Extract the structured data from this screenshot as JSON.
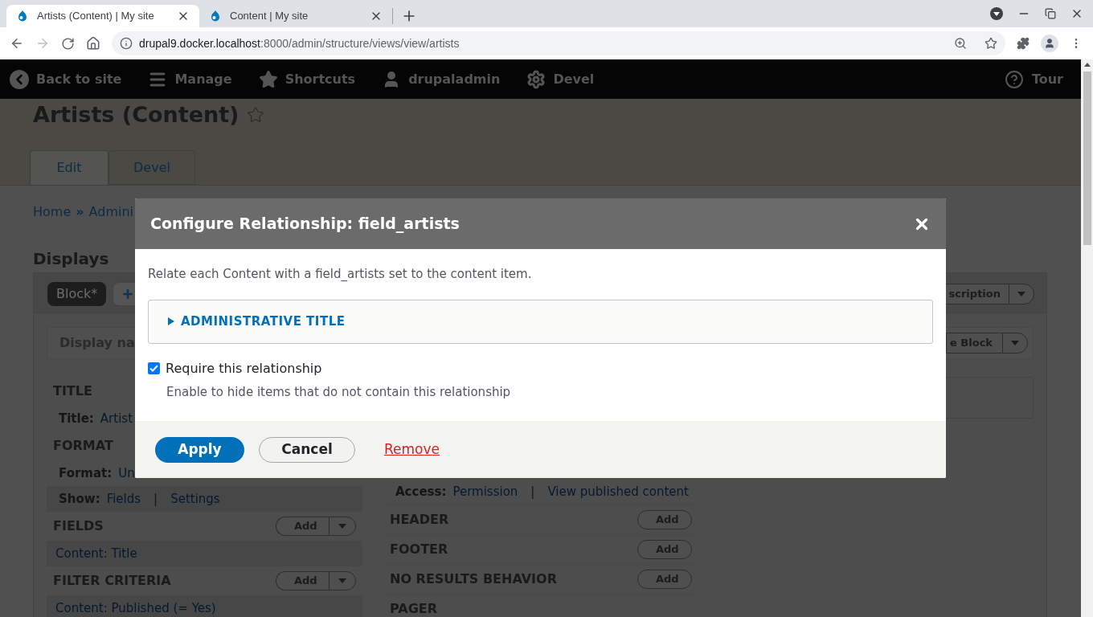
{
  "browser": {
    "tabs": [
      {
        "title": "Artists (Content) | My site",
        "selected": true
      },
      {
        "title": "Content | My site",
        "selected": false
      }
    ],
    "url_host": "drupal9.docker.localhost",
    "url_path": ":8000/admin/structure/views/view/artists"
  },
  "toolbar": {
    "items": [
      {
        "label": "Back to site",
        "kind": "back"
      },
      {
        "label": "Manage",
        "kind": "menu"
      },
      {
        "label": "Shortcuts",
        "kind": "star"
      },
      {
        "label": "drupaladmin",
        "kind": "user"
      },
      {
        "label": "Devel",
        "kind": "gear"
      }
    ],
    "tour": "Tour"
  },
  "page": {
    "title": "Artists (Content)",
    "tabs": [
      {
        "label": "Edit",
        "selected": true
      },
      {
        "label": "Devel",
        "selected": false
      }
    ],
    "breadcrumb": {
      "items": [
        "Home",
        "Admini"
      ],
      "separator": "»"
    },
    "displays": {
      "heading": "Displays",
      "display_tabs": [
        {
          "label": "Block*",
          "selected": true
        }
      ],
      "right_button": "scription",
      "display_name_label": "Display na",
      "display_name_button": "e Block",
      "link_separator": "|",
      "left_sections": [
        {
          "heading": "TITLE",
          "rows": [
            {
              "label": "Title:",
              "links": [
                "Artist"
              ]
            }
          ]
        },
        {
          "heading": "FORMAT",
          "rows": [
            {
              "label": "Format:",
              "links": [
                "Un"
              ]
            },
            {
              "label": "Show:",
              "links": [
                "Fields",
                "Settings"
              ]
            }
          ]
        },
        {
          "heading": "FIELDS",
          "add": "Add",
          "dropdown": true,
          "items": [
            "Content: Title"
          ]
        },
        {
          "heading": "FILTER CRITERIA",
          "add": "Add",
          "dropdown": true,
          "items": [
            "Content: Published (= Yes)"
          ]
        }
      ],
      "right_rows": [
        {
          "label": "Access:",
          "links": [
            "Permission",
            "View published content"
          ]
        }
      ],
      "right_sections": [
        {
          "heading": "HEADER",
          "add": "Add",
          "dropdown": false
        },
        {
          "heading": "FOOTER",
          "add": "Add",
          "dropdown": false
        },
        {
          "heading": "NO RESULTS BEHAVIOR",
          "add": "Add",
          "dropdown": false
        },
        {
          "heading": "PAGER"
        }
      ]
    }
  },
  "modal": {
    "title": "Configure Relationship: field_artists",
    "description": "Relate each Content with a field_artists set to the content item.",
    "details": {
      "summary": "ADMINISTRATIVE TITLE",
      "expanded": false
    },
    "checkbox": {
      "label": "Require this relationship",
      "description": "Enable to hide items that do not contain this relationship",
      "checked": true
    },
    "buttons": [
      {
        "label": "Apply",
        "kind": "primary"
      },
      {
        "label": "Cancel",
        "kind": "secondary"
      },
      {
        "label": "Remove",
        "kind": "link"
      }
    ]
  }
}
